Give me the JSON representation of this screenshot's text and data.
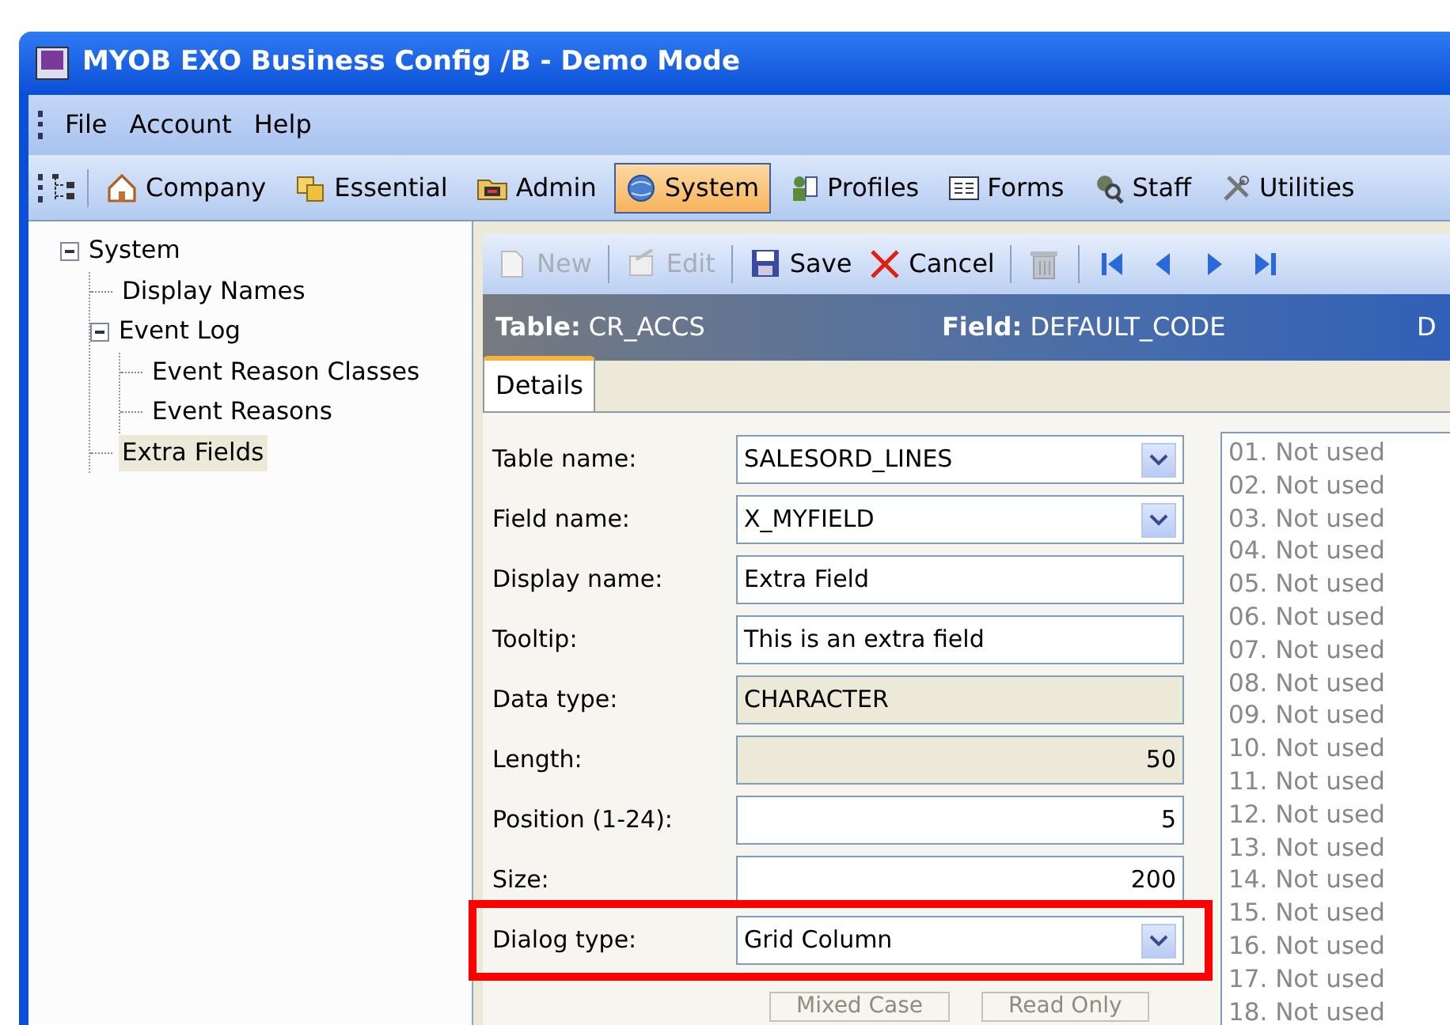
{
  "window": {
    "title": "MYOB EXO Business Config /B - Demo Mode"
  },
  "menu": [
    "File",
    "Account",
    "Help"
  ],
  "toolbar": [
    {
      "label": "Company",
      "selected": false
    },
    {
      "label": "Essential",
      "selected": false
    },
    {
      "label": "Admin",
      "selected": false
    },
    {
      "label": "System",
      "selected": true
    },
    {
      "label": "Profiles",
      "selected": false
    },
    {
      "label": "Forms",
      "selected": false
    },
    {
      "label": "Staff",
      "selected": false
    },
    {
      "label": "Utilities",
      "selected": false
    }
  ],
  "tree": [
    {
      "label": "System",
      "expanded": true,
      "selected": false,
      "children": [
        {
          "label": "Display Names",
          "selected": false
        },
        {
          "label": "Event Log",
          "expanded": true,
          "selected": false,
          "children": [
            {
              "label": "Event Reason Classes",
              "selected": false
            },
            {
              "label": "Event Reasons",
              "selected": false
            }
          ]
        },
        {
          "label": "Extra Fields",
          "selected": true
        }
      ]
    }
  ],
  "record_toolbar": [
    {
      "kind": "button",
      "label": "New",
      "disabled": true
    },
    {
      "kind": "button",
      "label": "Edit",
      "disabled": true
    },
    {
      "kind": "button",
      "label": "Save",
      "disabled": false
    },
    {
      "kind": "button",
      "label": "Cancel",
      "disabled": false
    },
    {
      "kind": "icon",
      "disabled": true
    },
    {
      "kind": "icon",
      "disabled": false
    },
    {
      "kind": "icon",
      "disabled": false
    },
    {
      "kind": "icon",
      "disabled": false
    },
    {
      "kind": "icon",
      "disabled": false
    }
  ],
  "record_header": [
    "**Table:** CR_ACCS",
    "**Field:** DEFAULT_CODE",
    "D"
  ],
  "tabs": [
    {
      "label": "Details",
      "selected": true
    }
  ],
  "fields": [
    {
      "label": "Table name:",
      "kind": "combo",
      "value": "SALESORD_LINES"
    },
    {
      "label": "Field name:",
      "kind": "combo",
      "value": "X_MYFIELD"
    },
    {
      "label": "Display name:",
      "kind": "text",
      "value": "Extra Field"
    },
    {
      "label": "Tooltip:",
      "kind": "text",
      "value": "This is an extra field"
    },
    {
      "label": "Data type:",
      "kind": "readonly",
      "value": "CHARACTER"
    },
    {
      "label": "Length:",
      "kind": "readonly_number",
      "value": "50"
    },
    {
      "label": "Position (1-24):",
      "kind": "number",
      "value": "5"
    },
    {
      "label": "Size:",
      "kind": "number",
      "value": "200"
    },
    {
      "label": "Dialog type:",
      "kind": "combo",
      "value": "Grid Column",
      "highlighted": true
    }
  ],
  "options": [
    {
      "label": "Mixed Case",
      "checked": false,
      "disabled": true
    },
    {
      "label": "Read Only",
      "checked": false,
      "disabled": true
    }
  ],
  "slots": [
    "01. Not used",
    "02. Not used",
    "03. Not used",
    "04. Not used",
    "05. Not used",
    "06. Not used",
    "07. Not used",
    "08. Not used",
    "09. Not used",
    "10. Not used",
    "11. Not used",
    "12. Not used",
    "13. Not used",
    "14. Not used",
    "15. Not used",
    "16. Not used",
    "17. Not used",
    "18. Not used"
  ]
}
